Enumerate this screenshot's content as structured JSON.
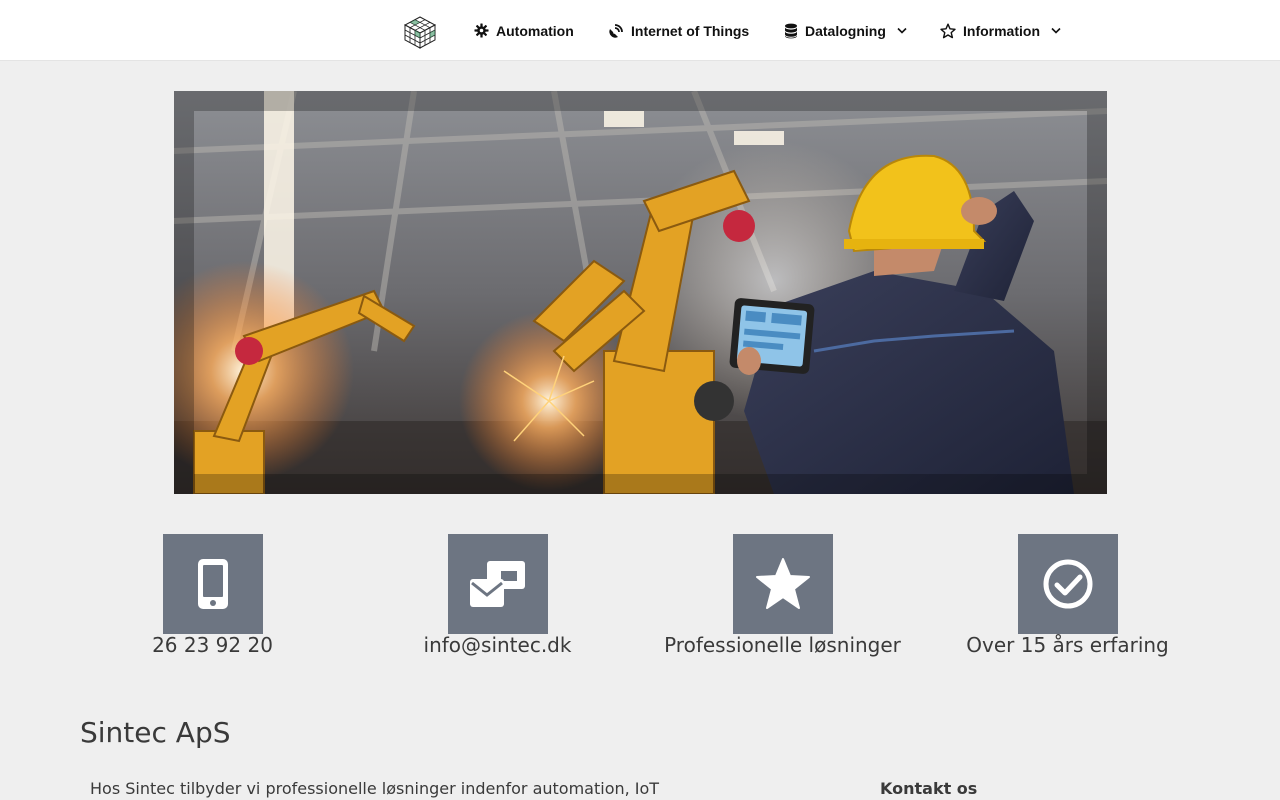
{
  "header": {
    "logo_icon": "rubiks-cube-icon",
    "nav": [
      {
        "label": "Automation",
        "icon": "gear-icon",
        "has_dropdown": false
      },
      {
        "label": "Internet of Things",
        "icon": "satellite-dish-icon",
        "has_dropdown": false
      },
      {
        "label": "Datalogning",
        "icon": "database-icon",
        "has_dropdown": true
      },
      {
        "label": "Information",
        "icon": "star-outline-icon",
        "has_dropdown": true
      }
    ]
  },
  "hero": {
    "subject": "industrial-robots-engineer-tablet-photo"
  },
  "features": [
    {
      "icon": "mobile-phone-icon",
      "text": "26 23 92 20"
    },
    {
      "icon": "mail-bulk-icon",
      "text": "info@sintec.dk"
    },
    {
      "icon": "star-icon",
      "text": "Professionelle løsninger"
    },
    {
      "icon": "check-circle-icon",
      "text": "Over 15 års erfaring"
    }
  ],
  "main": {
    "company_title": "Sintec ApS",
    "intro_text": "Hos Sintec tilbyder vi professionelle løsninger indenfor automation, IoT",
    "contact_heading": "Kontakt os"
  },
  "colors": {
    "feature_box": "#6d7582",
    "page_bg": "#efefef",
    "header_bg": "#ffffff"
  }
}
